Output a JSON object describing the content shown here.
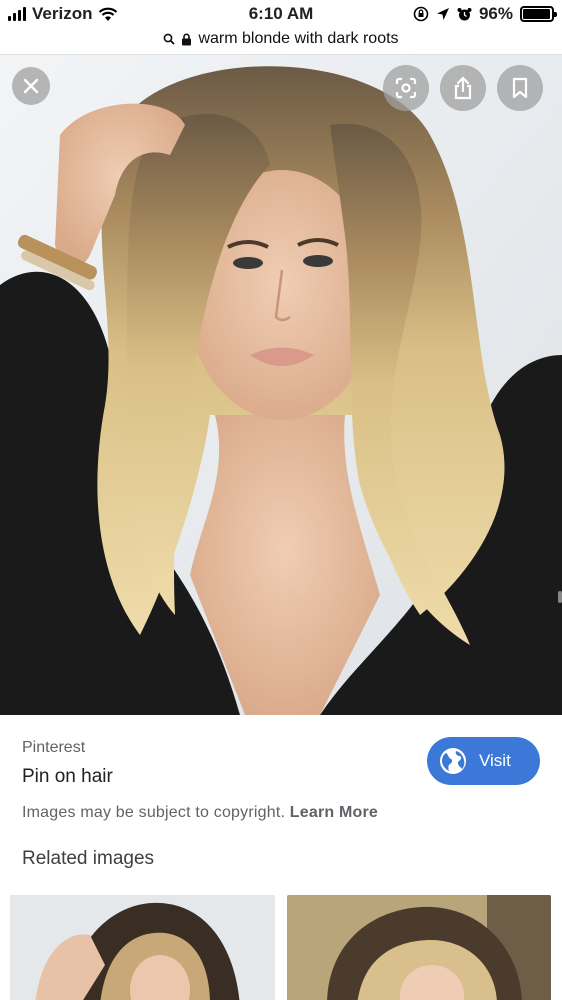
{
  "status_bar": {
    "carrier": "Verizon",
    "time": "6:10 AM",
    "battery": "96%",
    "battery_level": 0.96
  },
  "url_bar": {
    "query": "warm blonde with dark roots"
  },
  "image_viewer": {
    "close_icon": "close-icon",
    "lens_icon": "lens-icon",
    "share_icon": "share-icon",
    "save_icon": "bookmark-icon"
  },
  "info": {
    "source": "Pinterest",
    "title": "Pin on hair",
    "visit_label": "Visit",
    "copyright_text": "Images may be subject to copyright.",
    "learn_more": "Learn More",
    "related_heading": "Related images"
  },
  "colors": {
    "visit_button": "#3c78d8",
    "overlay_button": "#a0a0a0"
  }
}
